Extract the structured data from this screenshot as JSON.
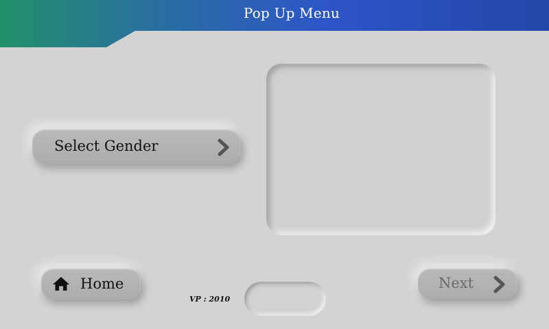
{
  "header": {
    "title": "Pop Up Menu",
    "gradient_left": "#22906a",
    "gradient_right": "#2b4fbe"
  },
  "main": {
    "select_gender": {
      "label": "Select Gender",
      "icon": "chevron-right-icon"
    },
    "home": {
      "label": "Home",
      "icon": "home-icon"
    },
    "next": {
      "label": "Next",
      "icon": "chevron-right-icon"
    },
    "version_text": "VP : 2010"
  },
  "colors": {
    "background": "#d3d3d3",
    "button": "#b3b3b3",
    "chevron": "#555555"
  }
}
